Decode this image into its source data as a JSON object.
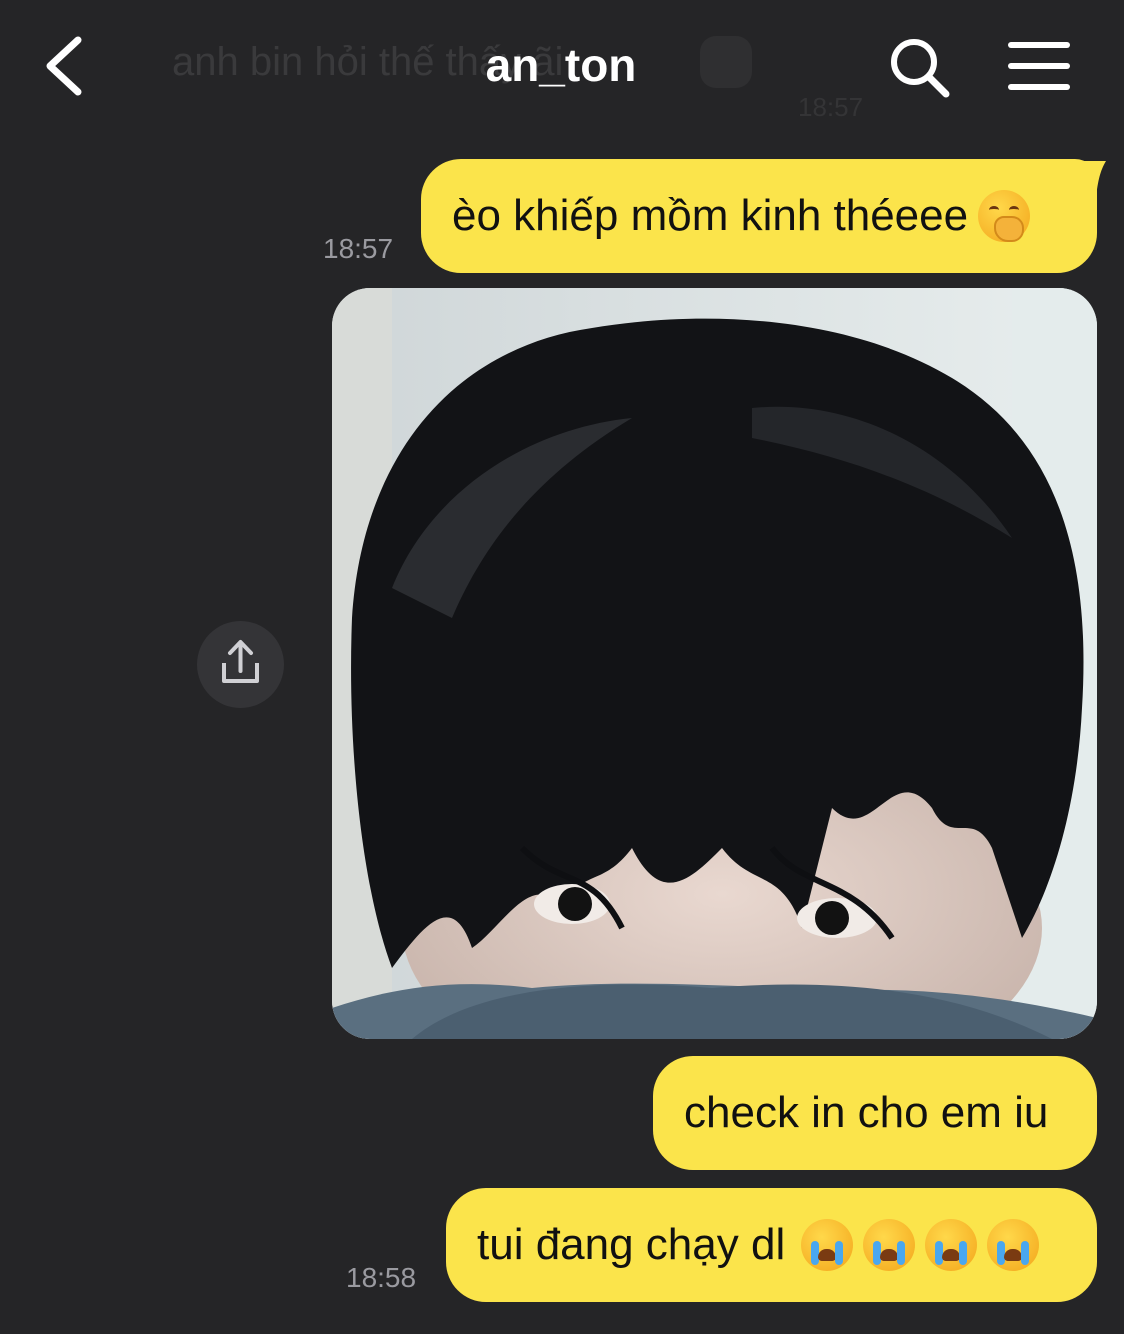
{
  "header": {
    "title": "an_ton",
    "ghost_message": "anh bin hỏi thế thấy ãi",
    "ghost_time": "18:57"
  },
  "messages": [
    {
      "text": "èo khiếp mồm kinh théeee",
      "time": "18:57",
      "emoji": "face-with-hand-over-mouth"
    },
    {
      "type": "photo",
      "alt": "selfie photo"
    },
    {
      "text": "check in cho em iu"
    },
    {
      "text": "tui đang chạy dl",
      "time": "18:58",
      "emoji": "loudly-crying-face x4"
    }
  ],
  "colors": {
    "background": "#252527",
    "bubble": "#fbe44b",
    "text_on_bubble": "#111111",
    "timestamp": "#9a9aa0",
    "header_text": "#ffffff"
  },
  "icons": [
    "back-chevron-icon",
    "search-icon",
    "menu-icon",
    "share-icon"
  ]
}
